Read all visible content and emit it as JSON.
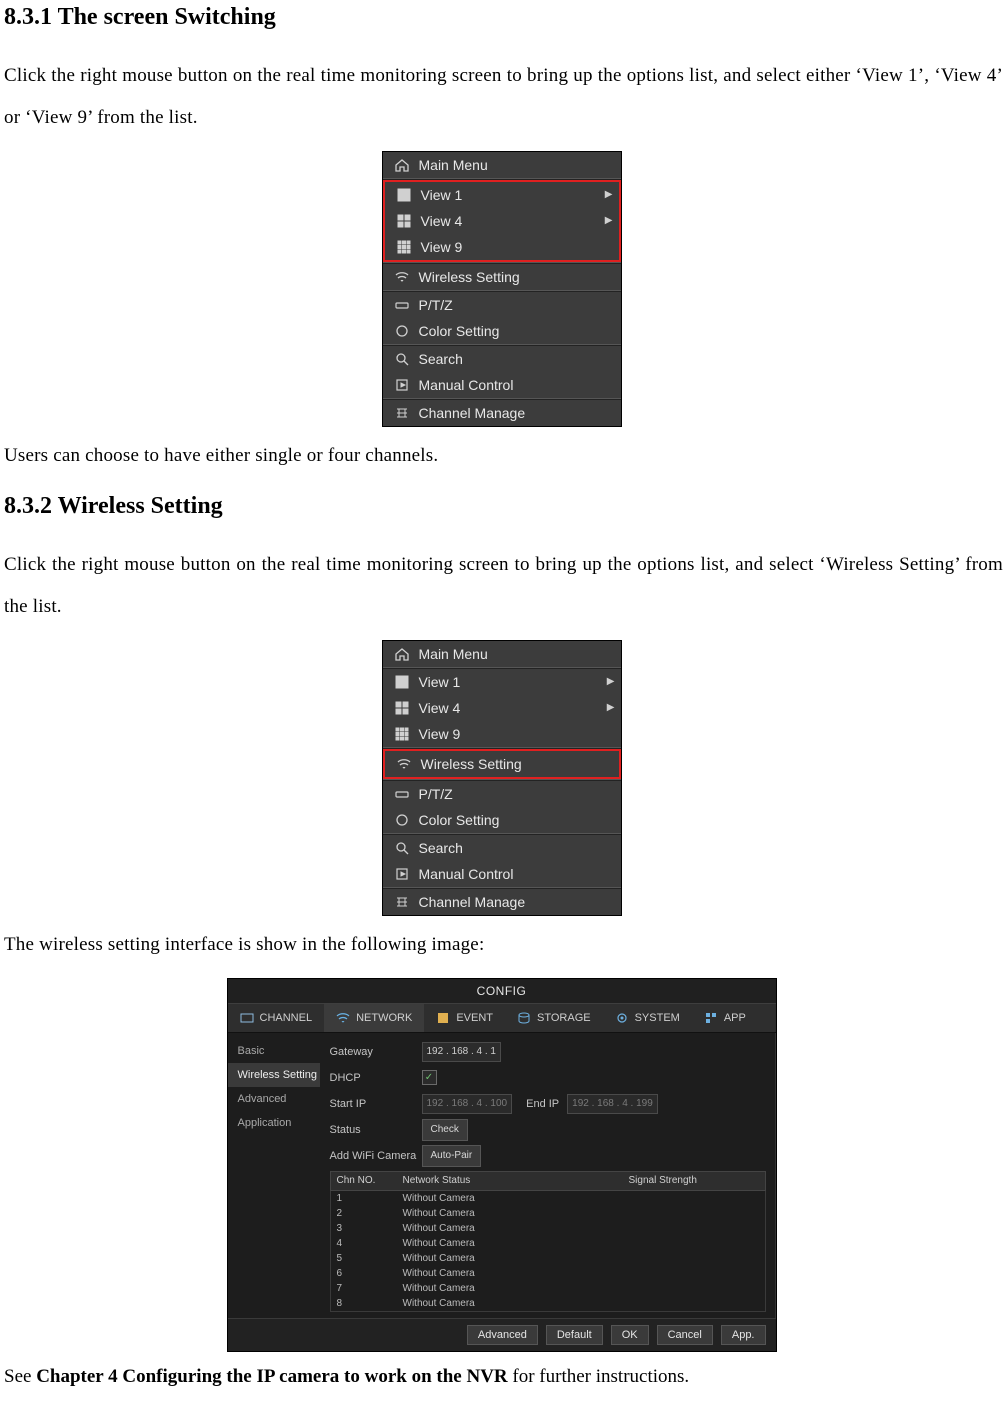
{
  "sections": {
    "s831": "8.3.1   The screen Switching",
    "p831a": "Click the right mouse button on the real time monitoring screen to bring up the options list, and select either ‘View 1’, ‘View 4’ or ‘View 9’ from the list.",
    "p831b": "Users can choose to have either single or four channels.",
    "s832": "8.3.2   Wireless Setting",
    "p832a": "Click the right mouse button on the real time monitoring screen to bring up the options list, and select ‘Wireless Setting’ from the list.",
    "p832b": "The wireless setting interface is show in the following image:",
    "see_prefix": "See ",
    "see_bold": "Chapter 4 Configuring the IP camera to work on the NVR",
    "see_suffix": " for further instructions."
  },
  "ctx": {
    "main_menu": "Main Menu",
    "view1": "View 1",
    "view4": "View 4",
    "view9": "View 9",
    "wireless": "Wireless Setting",
    "ptz": "P/T/Z",
    "color": "Color Setting",
    "search": "Search",
    "manual": "Manual Control",
    "channel": "Channel Manage",
    "arrow": "▶"
  },
  "cfg": {
    "title": "CONFIG",
    "tabs": {
      "channel": "CHANNEL",
      "network": "NETWORK",
      "event": "EVENT",
      "storage": "STORAGE",
      "system": "SYSTEM",
      "app": "APP"
    },
    "side": {
      "basic": "Basic",
      "wireless": "Wireless Setting",
      "advanced": "Advanced",
      "application": "Application"
    },
    "labels": {
      "gateway": "Gateway",
      "dhcp": "DHCP",
      "startip": "Start IP",
      "endip": "End IP",
      "status": "Status",
      "addwifi": "Add WiFi Camera"
    },
    "values": {
      "gateway": "192 . 168 .  4  .  1",
      "startip": "192 . 168 .  4  . 100",
      "endip": "192 . 168 .  4  . 199",
      "check_btn": "Check",
      "autopair_btn": "Auto-Pair",
      "dhcp_check": "✓"
    },
    "table": {
      "head": {
        "chn": "Chn NO.",
        "net": "Network Status",
        "sig": "Signal Strength"
      },
      "rows": [
        {
          "n": "1",
          "s": "Without Camera"
        },
        {
          "n": "2",
          "s": "Without Camera"
        },
        {
          "n": "3",
          "s": "Without Camera"
        },
        {
          "n": "4",
          "s": "Without Camera"
        },
        {
          "n": "5",
          "s": "Without Camera"
        },
        {
          "n": "6",
          "s": "Without Camera"
        },
        {
          "n": "7",
          "s": "Without Camera"
        },
        {
          "n": "8",
          "s": "Without Camera"
        }
      ]
    },
    "foot": {
      "advanced": "Advanced",
      "default": "Default",
      "ok": "OK",
      "cancel": "Cancel",
      "app": "App."
    }
  }
}
